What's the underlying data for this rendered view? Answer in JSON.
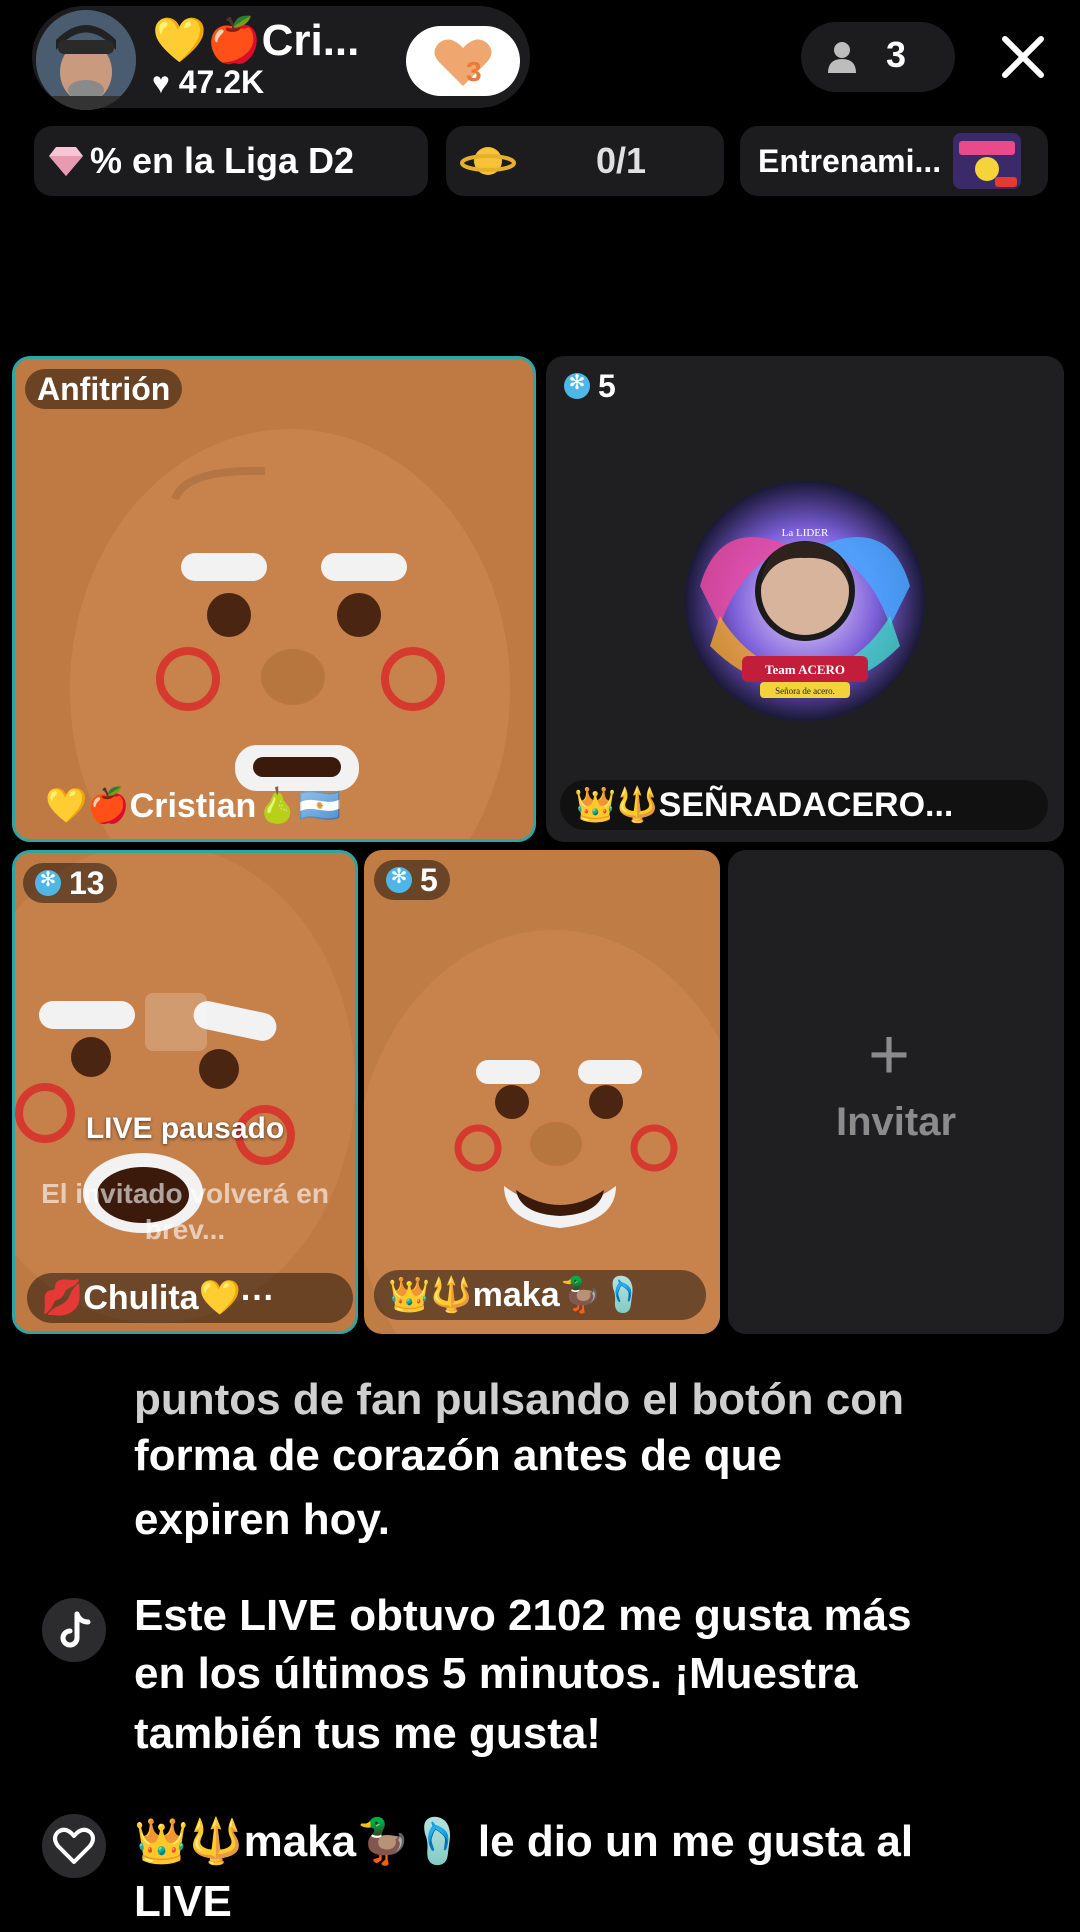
{
  "header": {
    "host_name": "Cri...",
    "host_name_emojis": "💛🍎",
    "likes": "47.2K",
    "follow_badge_count": "3",
    "viewer_count": "3"
  },
  "chips": {
    "league": "% en la Liga D2",
    "goal": "0/1",
    "training": "Entrenami..."
  },
  "tiles": {
    "host": {
      "badge": "Anfitrión",
      "name": "💛🍎Cristian🍐🇦🇷"
    },
    "guest1": {
      "score": "5",
      "name": "👑🔱SEÑRADACERO...",
      "avatar_text_top": "La LIDER",
      "avatar_text_team": "Team ACERO",
      "avatar_text_bottom": "Señora de acero."
    },
    "guest2": {
      "score": "13",
      "name": "💋Chulita💛···",
      "paused_title": "LIVE pausado",
      "paused_sub": "El invitado volverá en brev..."
    },
    "guest3": {
      "score": "5",
      "name": "👑🔱maka🦆🩴"
    },
    "invite": {
      "plus": "+",
      "label": "Invitar"
    }
  },
  "chat": [
    {
      "text": "puntos de fan pulsando el botón con",
      "faded": true
    },
    {
      "text": "forma de corazón antes de que"
    },
    {
      "text": "expiren hoy."
    },
    {
      "text": "Este LIVE obtuvo 2102 me gusta más"
    },
    {
      "text": "en los últimos 5 minutos. ¡Muestra"
    },
    {
      "text": "también tus me gusta!"
    },
    {
      "text": "👑🔱maka🦆🩴 le dio un me gusta al"
    },
    {
      "text": "LIVE"
    }
  ]
}
